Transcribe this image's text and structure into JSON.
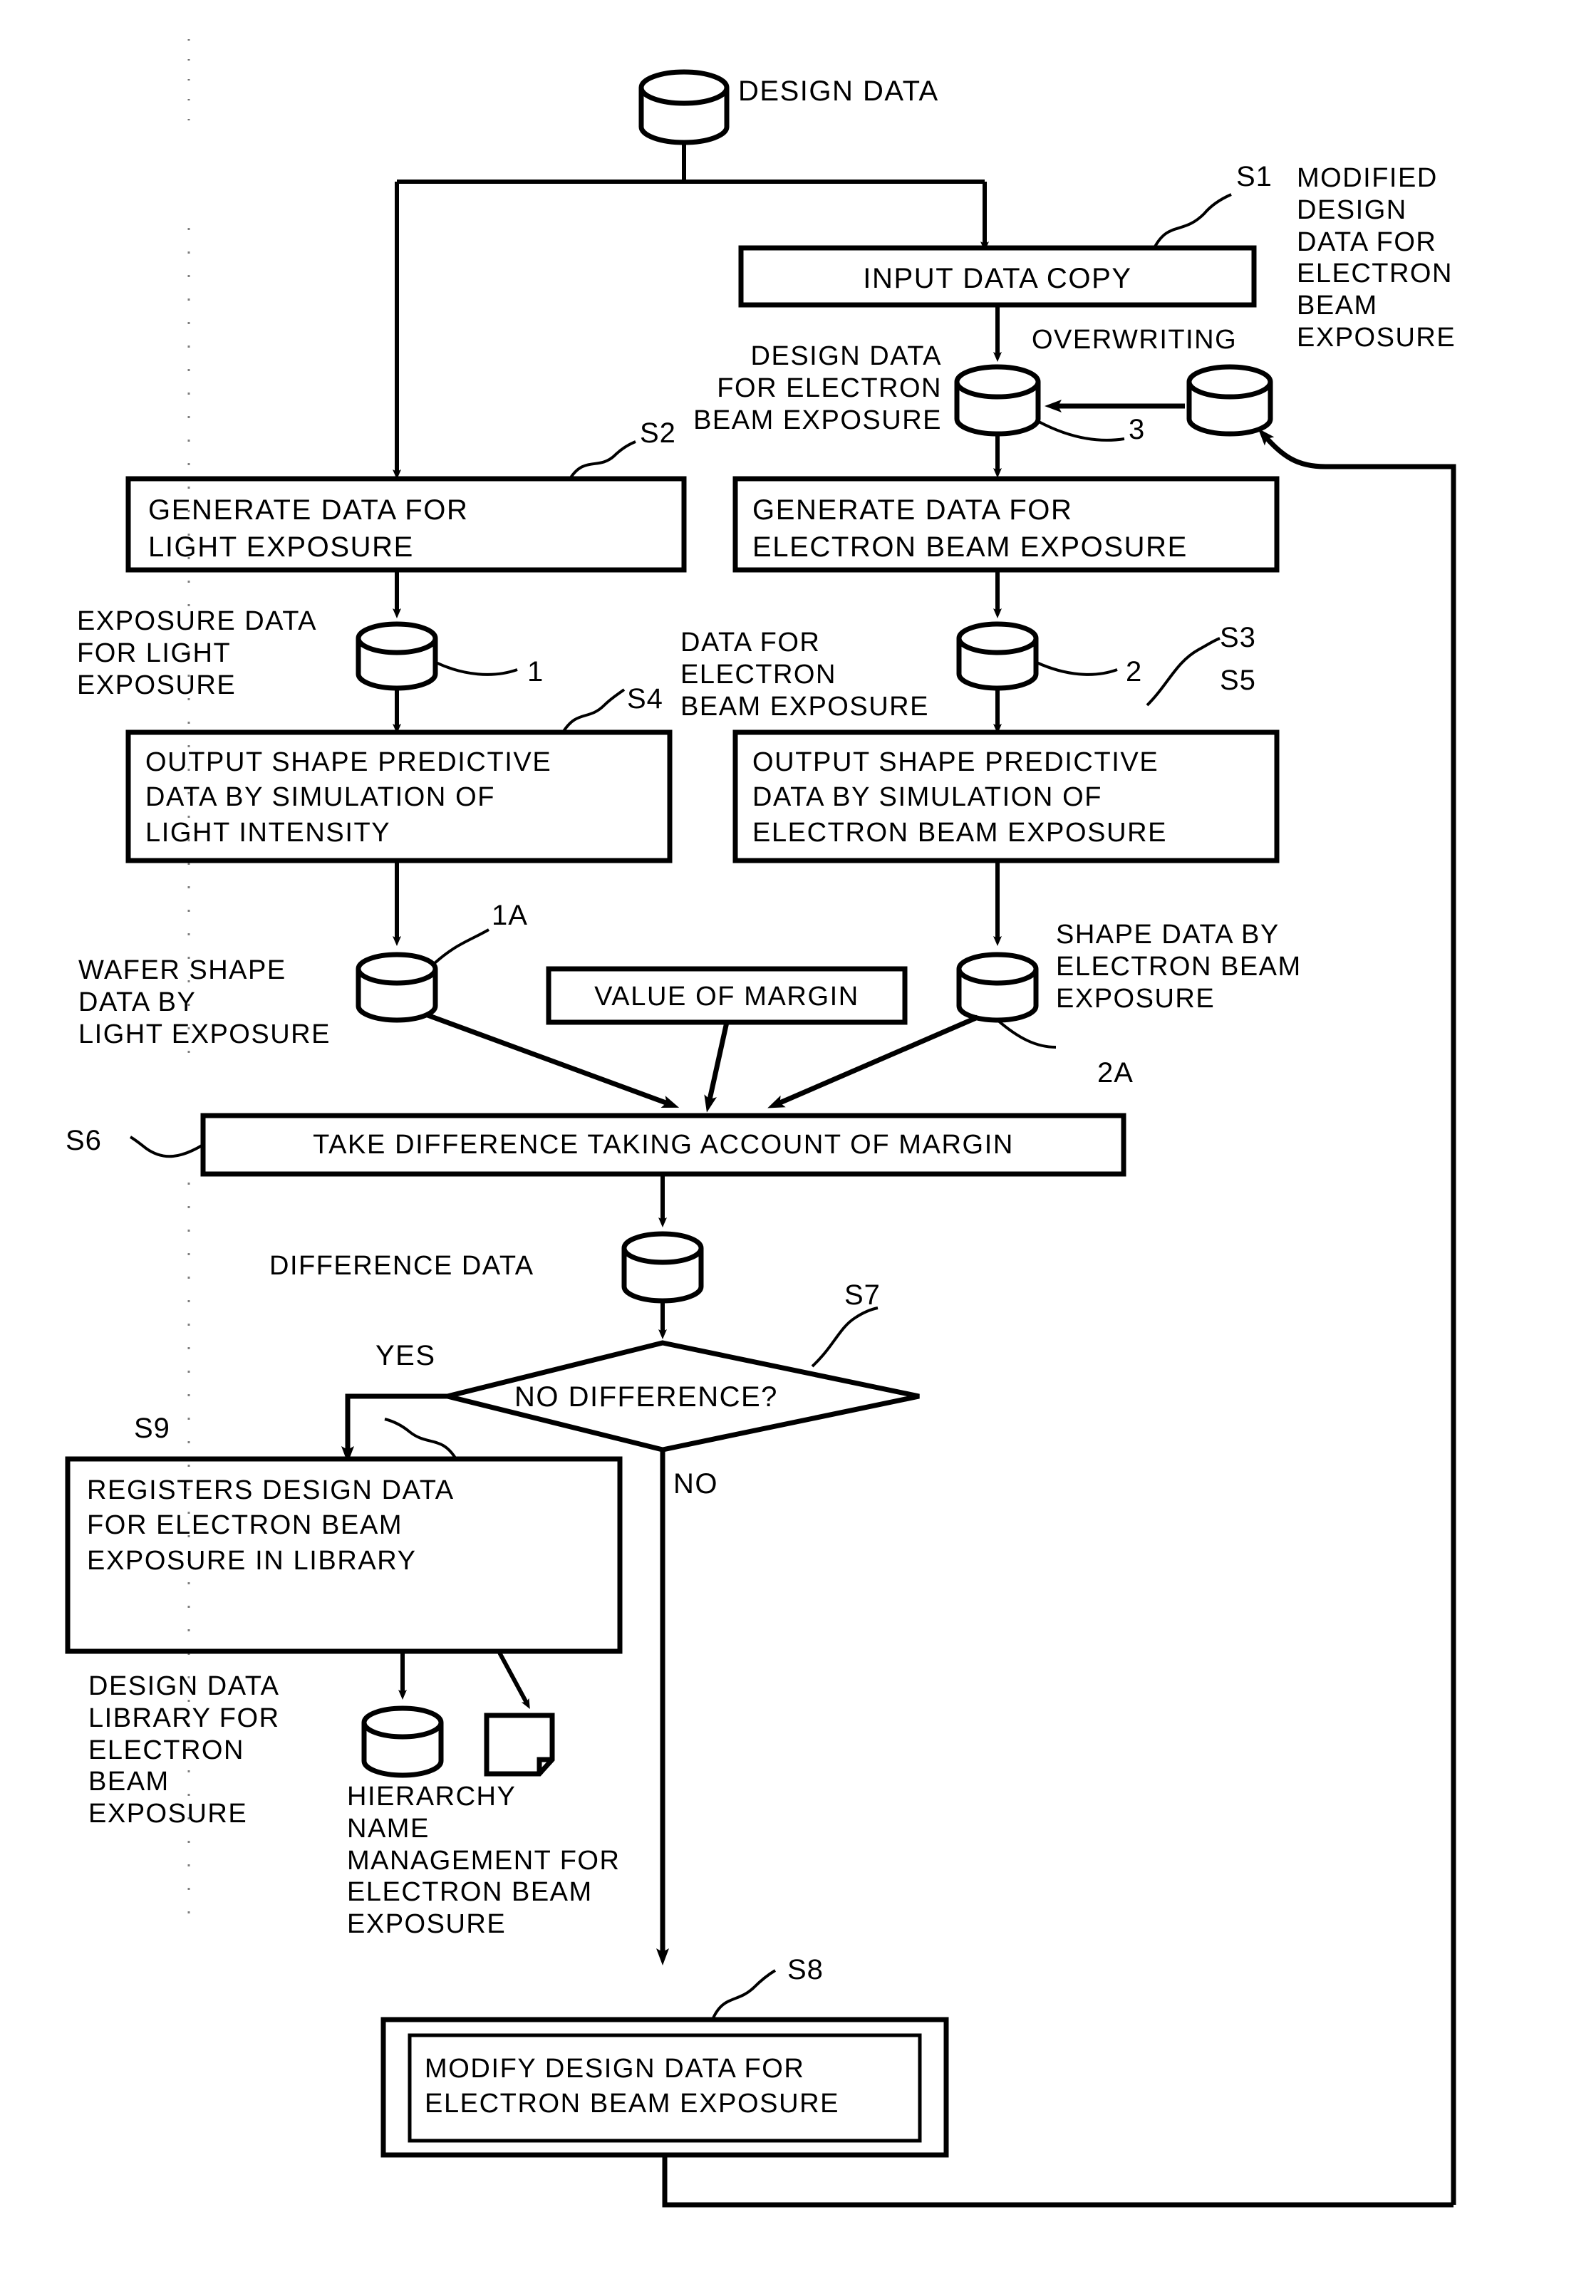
{
  "figure": {
    "type": "patent-flowchart",
    "title": "Electron beam exposure data generation flow"
  },
  "nodes": {
    "design_data_store": "DESIGN DATA",
    "input_data_copy": "INPUT DATA COPY",
    "overwriting": "OVERWRITING",
    "design_data_for_eb": "DESIGN DATA\nFOR ELECTRON\nBEAM EXPOSURE",
    "modified_design_data_for_eb": "MODIFIED\nDESIGN\nDATA FOR\nELECTRON\nBEAM\nEXPOSURE",
    "generate_light": "GENERATE DATA FOR\nLIGHT EXPOSURE",
    "generate_eb": "GENERATE DATA FOR\nELECTRON BEAM EXPOSURE",
    "exposure_data_light": "EXPOSURE DATA\nFOR LIGHT\nEXPOSURE",
    "data_for_eb": "DATA FOR\nELECTRON\nBEAM EXPOSURE",
    "output_shape_light": "OUTPUT SHAPE PREDICTIVE\nDATA BY SIMULATION OF\nLIGHT INTENSITY",
    "output_shape_eb": "OUTPUT SHAPE PREDICTIVE\nDATA BY SIMULATION OF\nELECTRON BEAM EXPOSURE",
    "wafer_shape_light": "WAFER SHAPE\nDATA BY\nLIGHT EXPOSURE",
    "shape_data_eb": "SHAPE DATA BY\nELECTRON BEAM\nEXPOSURE",
    "value_of_margin": "VALUE OF MARGIN",
    "take_difference": "TAKE DIFFERENCE TAKING ACCOUNT OF MARGIN",
    "difference_data": "DIFFERENCE DATA",
    "no_difference": "NO DIFFERENCE?",
    "registers_design_data": "REGISTERS DESIGN DATA\nFOR ELECTRON BEAM\nEXPOSURE IN LIBRARY",
    "design_data_library": "DESIGN DATA\nLIBRARY FOR\nELECTRON\nBEAM\nEXPOSURE",
    "hierarchy_name": "HIERARCHY\nNAME\nMANAGEMENT FOR\nELECTRON BEAM\nEXPOSURE",
    "modify_design_data": "MODIFY DESIGN DATA FOR\nELECTRON BEAM EXPOSURE"
  },
  "branch_labels": {
    "yes": "YES",
    "no": "NO"
  },
  "step_refs": {
    "s1": "S1",
    "s2": "S2",
    "s3": "S3",
    "s4": "S4",
    "s5": "S5",
    "s6": "S6",
    "s7": "S7",
    "s8": "S8",
    "s9": "S9"
  },
  "item_refs": {
    "one": "1",
    "one_a": "1A",
    "two": "2",
    "two_a": "2A",
    "three": "3"
  },
  "colors": {
    "ink": "#000000",
    "paper": "#ffffff"
  }
}
